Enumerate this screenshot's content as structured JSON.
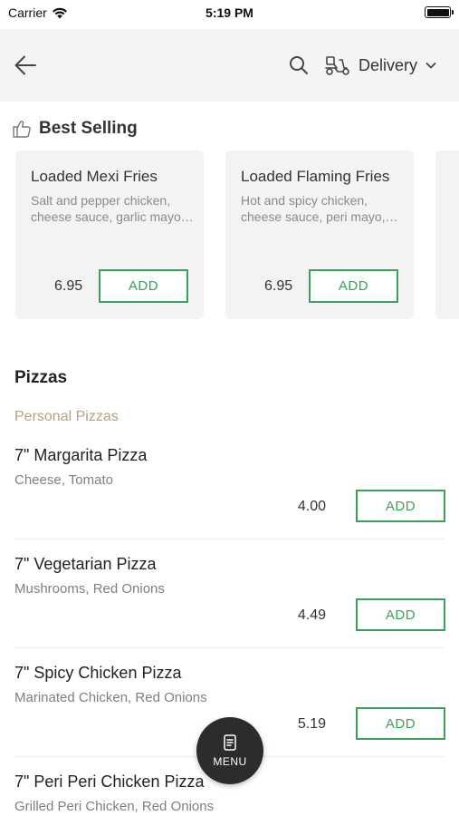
{
  "status_bar": {
    "carrier": "Carrier",
    "time": "5:19 PM"
  },
  "header": {
    "back_icon": "arrow-left-icon",
    "search_icon": "search-icon",
    "delivery_icon": "delivery-scooter-icon",
    "delivery_label": "Delivery",
    "chevron_icon": "chevron-down-icon"
  },
  "best_selling": {
    "title": "Best Selling",
    "icon": "thumbs-up-icon",
    "items": [
      {
        "name": "Loaded Mexi Fries",
        "desc": "Salt and pepper chicken, cheese sauce, garlic mayo…",
        "price": "6.95",
        "add_label": "ADD"
      },
      {
        "name": "Loaded Flaming Fries",
        "desc": "Hot and spicy chicken, cheese sauce, peri mayo,…",
        "price": "6.95",
        "add_label": "ADD"
      }
    ]
  },
  "category": {
    "title": "Pizzas",
    "subcategory": "Personal Pizzas",
    "items": [
      {
        "name": "7\" Margarita Pizza",
        "desc": "Cheese, Tomato",
        "price": "4.00",
        "add_label": "ADD"
      },
      {
        "name": "7\" Vegetarian Pizza",
        "desc": "Mushrooms, Red Onions",
        "price": "4.49",
        "add_label": "ADD"
      },
      {
        "name": "7\" Spicy Chicken Pizza",
        "desc": "Marinated Chicken, Red Onions",
        "price": "5.19",
        "add_label": "ADD"
      },
      {
        "name": "7\" Peri Peri Chicken Pizza",
        "desc": "Grilled Peri Chicken, Red Onions",
        "price": "",
        "add_label": ""
      }
    ]
  },
  "menu_button": {
    "label": "MENU",
    "icon": "menu-book-icon"
  },
  "colors": {
    "accent_green": "#3aa05a",
    "subcategory_gold": "#b3a37c",
    "header_bg": "#f4f4f4",
    "card_bg": "#f3f3f3",
    "fab_bg": "#2c2c2c"
  }
}
